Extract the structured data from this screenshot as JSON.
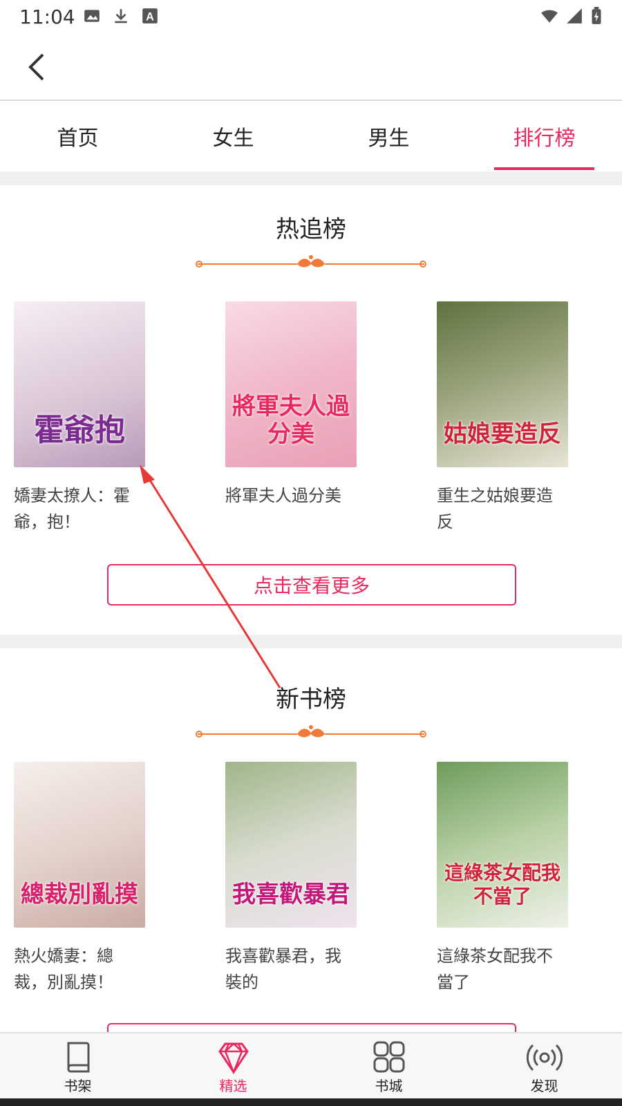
{
  "status_bar": {
    "time": "11:04"
  },
  "tabs": [
    {
      "label": "首页",
      "active": false
    },
    {
      "label": "女生",
      "active": false
    },
    {
      "label": "男生",
      "active": false
    },
    {
      "label": "排行榜",
      "active": true
    }
  ],
  "sections": [
    {
      "title": "热追榜",
      "more_label": "点击查看更多",
      "books": [
        {
          "title": "嬌妻太撩人：霍爺，抱！",
          "cover_text": "霍爺抱",
          "cover_colors": [
            "#f2e6ef",
            "#c9b2cc"
          ]
        },
        {
          "title": "將軍夫人過分美",
          "cover_text": "將軍夫人過分美",
          "cover_colors": [
            "#f5c9d6",
            "#e6a4b8"
          ]
        },
        {
          "title": "重生之姑娘要造反",
          "cover_text": "姑娘要造反",
          "cover_colors": [
            "#7f8f4e",
            "#c7c6a0"
          ]
        }
      ]
    },
    {
      "title": "新书榜",
      "books": [
        {
          "title": "熱火嬌妻：總裁，別亂摸！",
          "cover_text": "總裁別亂摸",
          "cover_colors": [
            "#f1e9e6",
            "#d8c3bd"
          ]
        },
        {
          "title": "我喜歡暴君，我裝的",
          "cover_text": "我喜歡暴君",
          "cover_colors": [
            "#b8c7a3",
            "#e7e3ea"
          ]
        },
        {
          "title": "這綠茶女配我不當了",
          "cover_text": "這綠茶女配我不當了",
          "cover_colors": [
            "#8fb27a",
            "#e7ecde"
          ]
        }
      ]
    }
  ],
  "bottom_nav": [
    {
      "label": "书架",
      "icon": "book-icon",
      "active": false
    },
    {
      "label": "精选",
      "icon": "diamond-icon",
      "active": true
    },
    {
      "label": "书城",
      "icon": "grid-icon",
      "active": false
    },
    {
      "label": "发现",
      "icon": "broadcast-icon",
      "active": false
    }
  ],
  "colors": {
    "accent": "#e8295f",
    "ornament": "#f07a3a"
  }
}
